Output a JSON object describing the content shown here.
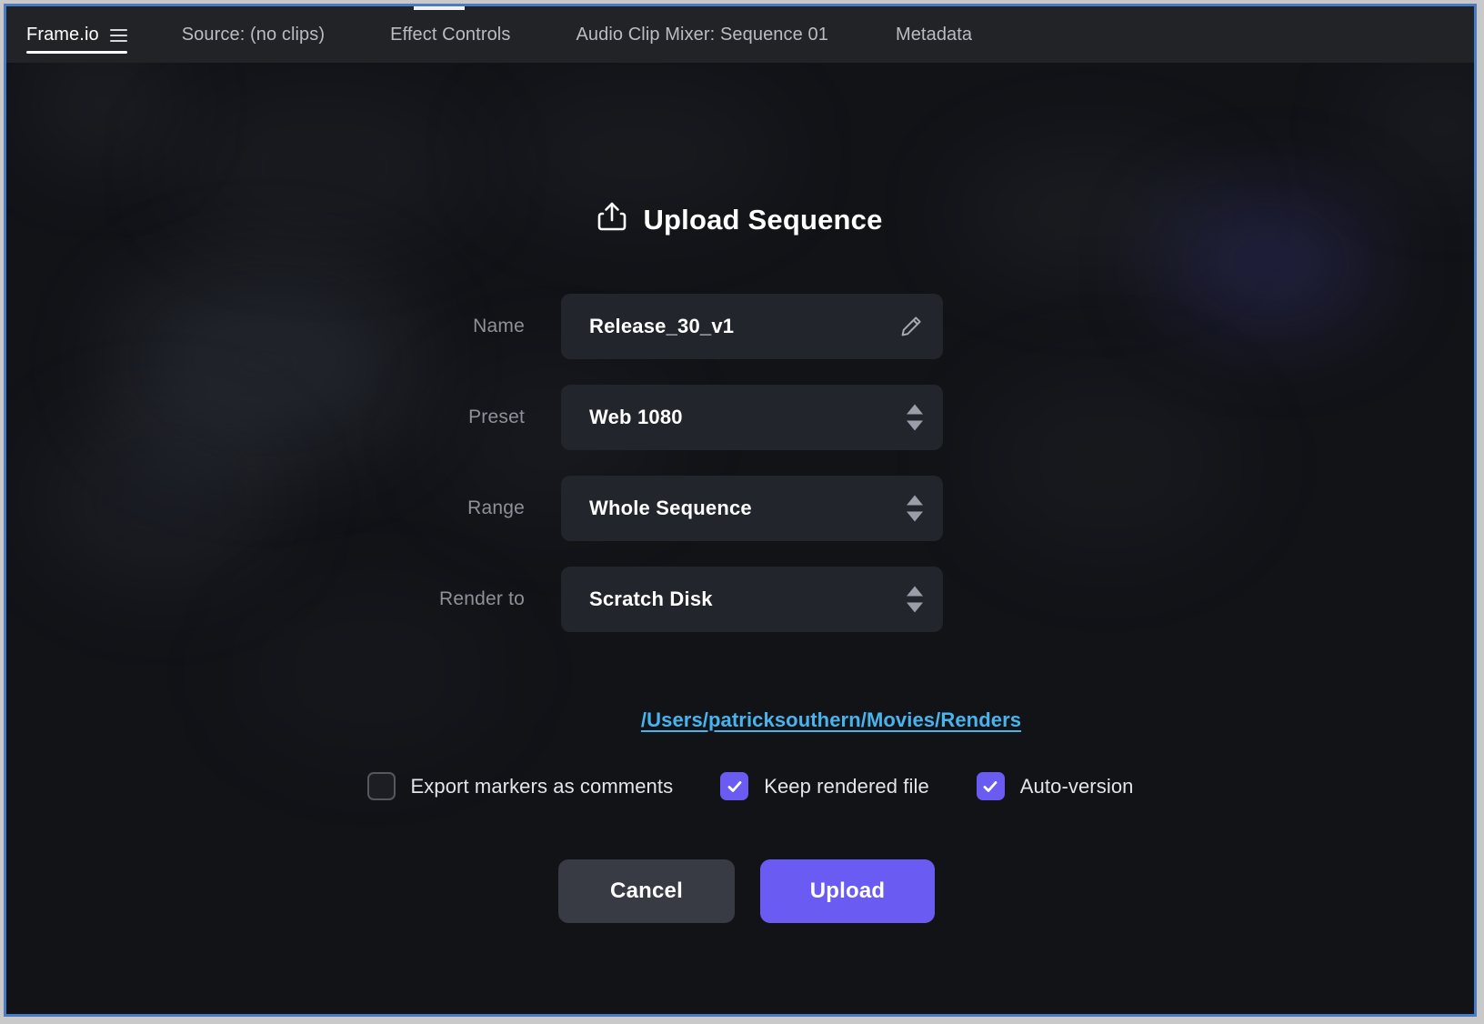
{
  "window": {
    "accent_border_color": "#4a7cc4",
    "background_color": "#121317"
  },
  "tabs": [
    {
      "id": "frameio",
      "label": "Frame.io",
      "active": true,
      "has_menu_icon": true
    },
    {
      "id": "source",
      "label": "Source: (no clips)",
      "active": false,
      "has_menu_icon": false
    },
    {
      "id": "effects",
      "label": "Effect Controls",
      "active": false,
      "has_menu_icon": false
    },
    {
      "id": "audio",
      "label": "Audio Clip Mixer: Sequence 01",
      "active": false,
      "has_menu_icon": false
    },
    {
      "id": "metadata",
      "label": "Metadata",
      "active": false,
      "has_menu_icon": false
    }
  ],
  "dialog": {
    "title": "Upload Sequence",
    "title_icon": "upload-icon",
    "fields": {
      "name": {
        "label": "Name",
        "value": "Release_30_v1",
        "icon": "pencil-edit-icon",
        "type": "text"
      },
      "preset": {
        "label": "Preset",
        "value": "Web 1080",
        "icon": "stepper-arrows-icon",
        "type": "select"
      },
      "range": {
        "label": "Range",
        "value": "Whole Sequence",
        "icon": "stepper-arrows-icon",
        "type": "select"
      },
      "render_to": {
        "label": "Render to",
        "value": "Scratch Disk",
        "icon": "stepper-arrows-icon",
        "type": "select"
      }
    },
    "render_path": {
      "text": "/Users/patricksouthern/Movies/Renders",
      "color": "#47b4ee"
    },
    "checkboxes": [
      {
        "id": "export-markers",
        "label": "Export markers as comments",
        "checked": false
      },
      {
        "id": "keep-rendered",
        "label": "Keep rendered file",
        "checked": true
      },
      {
        "id": "auto-version",
        "label": "Auto-version",
        "checked": true
      }
    ],
    "buttons": {
      "cancel": {
        "label": "Cancel",
        "color": "#383a44"
      },
      "upload": {
        "label": "Upload",
        "color": "#6a5cf2"
      }
    }
  }
}
